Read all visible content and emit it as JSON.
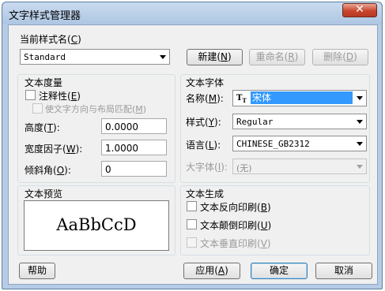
{
  "window": {
    "title": "文字样式管理器",
    "close_glyph": "✕"
  },
  "current_style": {
    "label": "当前样式名",
    "accel": "C",
    "value": "Standard",
    "new_label": "新建",
    "new_accel": "N",
    "rename_label": "重命名",
    "rename_accel": "R",
    "delete_label": "删除",
    "delete_accel": "D"
  },
  "metrics": {
    "header": "文本度量",
    "annotative_label": "注释性",
    "annotative_accel": "E",
    "annotative_checked": false,
    "match_orientation_label": "使文字方向与布局匹配",
    "match_orientation_accel": "M",
    "match_orientation_checked": false,
    "height_label": "高度",
    "height_accel": "T",
    "height_value": "0.0000",
    "width_factor_label": "宽度因子",
    "width_factor_accel": "W",
    "width_factor_value": "1.0000",
    "oblique_label": "倾斜角",
    "oblique_accel": "O",
    "oblique_value": "0"
  },
  "font": {
    "header": "文本字体",
    "name_label": "名称",
    "name_accel": "M",
    "name_value": "宋体",
    "name_icon": "truetype-icon",
    "style_label": "样式",
    "style_accel": "Y",
    "style_value": "Regular",
    "language_label": "语言",
    "language_accel": "L",
    "language_value": "CHINESE_GB2312",
    "bigfont_label": "大字体",
    "bigfont_accel": "I",
    "bigfont_value": "(无)"
  },
  "preview": {
    "header": "文本预览",
    "sample": "AaBbCcD"
  },
  "generation": {
    "header": "文本生成",
    "backwards_label": "文本反向印刷",
    "backwards_accel": "B",
    "backwards_checked": false,
    "upside_down_label": "文本颠倒印刷",
    "upside_down_accel": "U",
    "upside_down_checked": false,
    "vertical_label": "文本垂直印刷",
    "vertical_accel": "V",
    "vertical_checked": false
  },
  "footer": {
    "help_label": "帮助",
    "apply_label": "应用",
    "apply_accel": "A",
    "ok_label": "确定",
    "cancel_label": "取消"
  }
}
